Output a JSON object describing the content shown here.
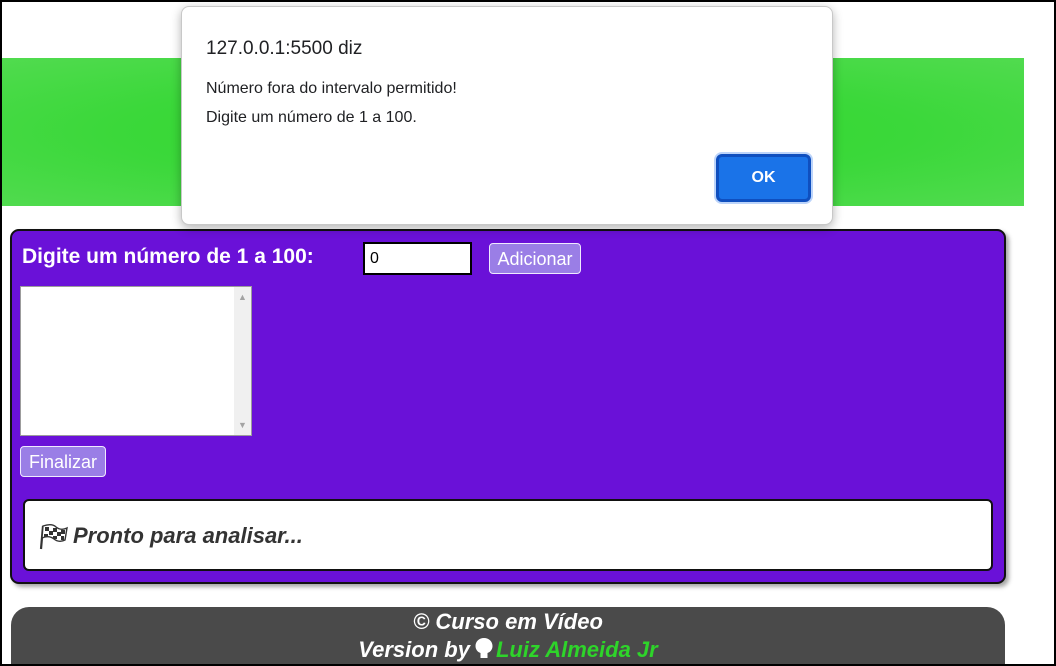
{
  "main": {
    "prompt_label": "Digite um número de 1 a 100:",
    "number_input_value": "0",
    "add_button_label": "Adicionar",
    "finish_button_label": "Finalizar",
    "result_text": "Pronto para analisar...",
    "result_icon": "checkered-flag-icon"
  },
  "footer": {
    "copyright": "© Curso em Vídeo",
    "version_prefix": "Version by",
    "author": "Luiz Almeida Jr",
    "author_icon": "github-icon"
  },
  "dialog": {
    "origin": "127.0.0.1:5500 diz",
    "message_line1": "Número fora do intervalo permitido!",
    "message_line2": "Digite um número de 1 a 100.",
    "ok_label": "OK"
  },
  "colors": {
    "header_green": "#3bd83a",
    "panel_purple": "#6a11d8",
    "button_purple": "#9a7ee6",
    "footer_gray": "#4a4a4a",
    "link_green": "#2ed42a",
    "dialog_blue": "#1a73e8"
  }
}
